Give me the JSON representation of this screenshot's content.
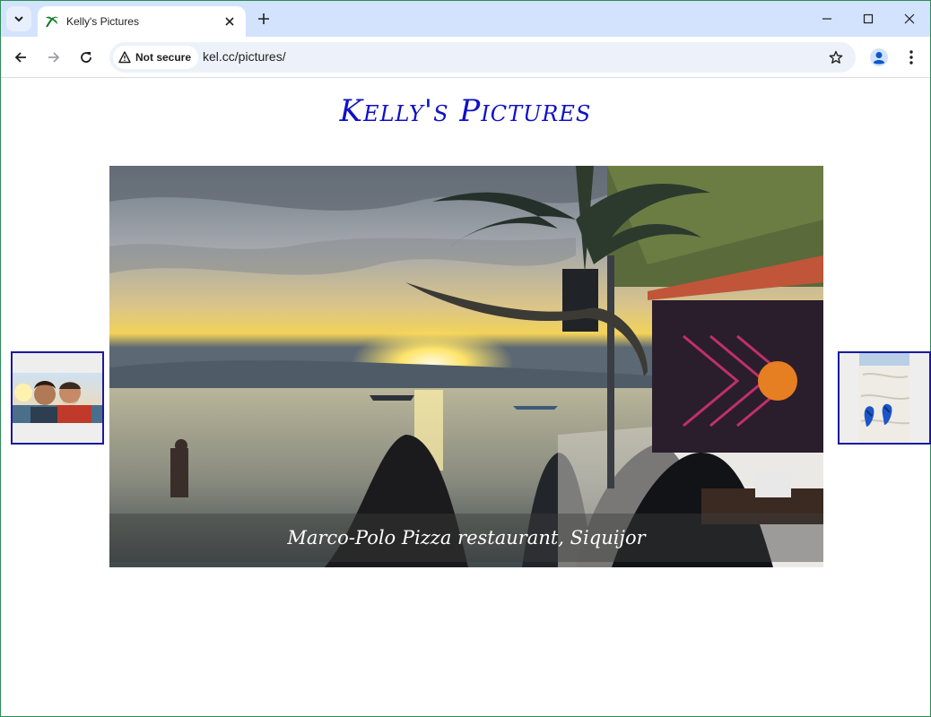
{
  "browser": {
    "tab_title": "Kelly's Pictures",
    "security_label": "Not secure",
    "url": "kel.cc/pictures/"
  },
  "page": {
    "title": "Kelly's Pictures",
    "caption": "Marco-Polo Pizza restaurant, Siquijor"
  },
  "icons": {
    "tab_search": "chevron-down-icon",
    "favicon": "palm-icon",
    "close": "close-icon",
    "new_tab": "plus-icon",
    "minimize": "minimize-icon",
    "maximize": "maximize-icon",
    "window_close": "close-icon",
    "back": "back-arrow-icon",
    "forward": "forward-arrow-icon",
    "reload": "reload-icon",
    "warning": "warning-icon",
    "bookmark": "star-icon",
    "profile": "profile-icon",
    "menu": "kebab-menu-icon"
  },
  "colors": {
    "title": "#1010c8",
    "tabstrip": "#d3e3fd",
    "thumb_border": "#1a1aa0"
  }
}
